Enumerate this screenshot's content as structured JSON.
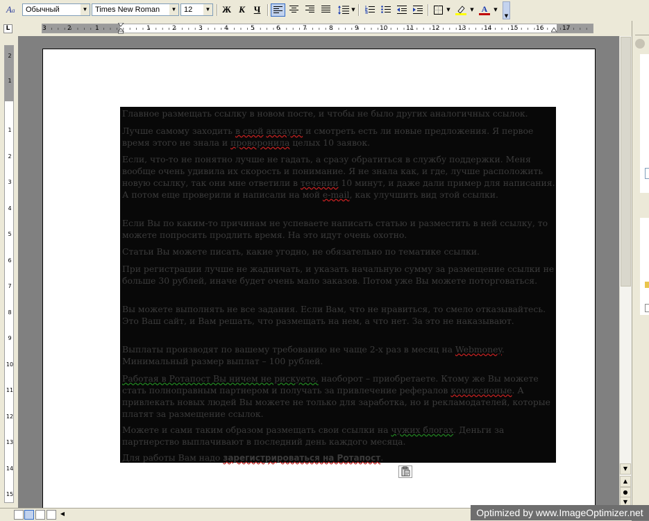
{
  "toolbar": {
    "style_value": "Обычный",
    "font_value": "Times New Roman",
    "size_value": "12",
    "bold_label": "Ж",
    "italic_label": "К",
    "underline_label": "Ч"
  },
  "hruler": {
    "numbers_left": [
      "3",
      "2",
      "1"
    ],
    "numbers_right": [
      "1",
      "2",
      "3",
      "4",
      "5",
      "6",
      "7",
      "8",
      "9",
      "10",
      "11",
      "12",
      "13",
      "14",
      "15",
      "16",
      "17"
    ]
  },
  "vruler": {
    "numbers": [
      "2",
      "1",
      "1",
      "2",
      "3",
      "4",
      "5",
      "6",
      "7",
      "8",
      "9",
      "10",
      "11",
      "12",
      "13",
      "14",
      "15"
    ]
  },
  "document": {
    "p1": "Главное размещать ссылку в новом посте, и чтобы не было других аналогичных ссылок.",
    "p2a": "Лучше самому заходить ",
    "p2b": "в свой",
    "p2c": " ",
    "p2d": "аккаунт",
    "p2e": " и смотреть есть ли новые предложения. Я первое время этого не знала и ",
    "p2f": "проворонила",
    "p2g": " целых 10 заявок.",
    "p3a": "Если, что-то не понятно лучше не гадать, а сразу обратиться в службу поддержки. Меня вообще очень удивила их скорость и понимание. Я не знала как, и где, лучше расположить новую ссылку, так они мне ответили в ",
    "p3b": "течении",
    "p3c": " 10 минут, и даже дали пример для написания. А потом еще проверили и написали на мой ",
    "p3d": "e-mail",
    "p3e": ", как улучшить вид этой ссылки.",
    "p4": "Если Вы по каким-то причинам не успеваете написать статью и разместить в ней ссылку, то можете попросить продлить время. На это идут очень охотно.",
    "p5": "Статьи Вы можете писать, какие угодно, не обязательно по тематике ссылки.",
    "p6": "При регистрации лучше не жадничать, и указать начальную сумму за размещение ссылки не больше 30 рублей, иначе будет очень мало заказов. Потом уже Вы можете поторговаться.",
    "p7": "Вы можете выполнять не все задания. Если Вам, что не нравиться, то смело отказывайтесь. Это Ваш сайт, и Вам решать, что размещать на нем, а что нет. За это не наказывают.",
    "p8a": "Выплаты производят по вашему требованию не чаще 2-х раз в месяц на ",
    "p8b": "Webmoney",
    "p8c": ". Минимальный размер выплат – 100 рублей.",
    "p9a": "Работая в Ротапост Вы ничем не рискуете,",
    "p9b": " наоборот – приобретаете. Ктому же Вы можете стать полноправным партнером и получать за привлечение рефералов ",
    "p9c": "комиссионые",
    "p9d": ". А привлекать новых людей Вы можете не только для заработка, но и рекламодателей, которые платят за размещение ссылок.",
    "p10a": "Можете и сами таким образом размещать свои ссылки на ",
    "p10b": "чужих блогах",
    "p10c": ". Деньги за партнерство выплачивают в последний день каждого месяца.",
    "p11a": "Для работы Вам надо ",
    "p11b": "зарегистрироваться на Ротапост",
    "p11c": "."
  },
  "watermark": "Optimized by www.ImageOptimizer.net",
  "colors": {
    "toolbar_bg": "#ece9d8",
    "text_block_bg": "#080808",
    "text_color": "#3b3b3b",
    "workspace_bg": "#808080"
  }
}
